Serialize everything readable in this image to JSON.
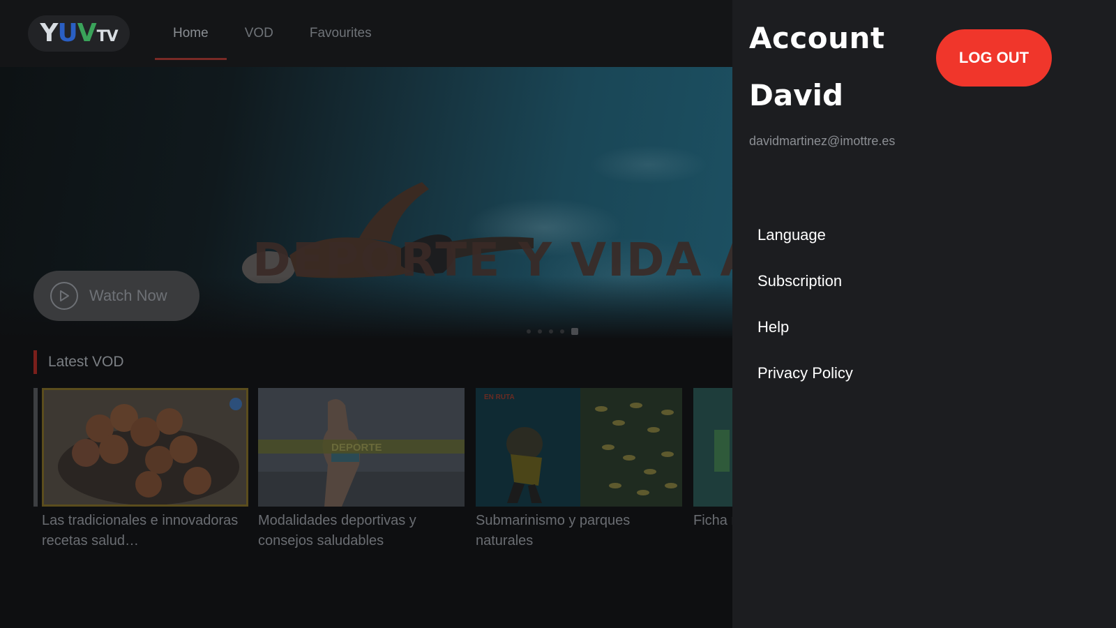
{
  "app": {
    "logo_text": {
      "y": "Y",
      "u": "U",
      "v": "V",
      "tv": "TV"
    }
  },
  "nav": {
    "tabs": [
      {
        "label": "Home",
        "active": true
      },
      {
        "label": "VOD",
        "active": false
      },
      {
        "label": "Favourites",
        "active": false
      }
    ]
  },
  "hero": {
    "title": "DEPORTE Y VIDA AC",
    "watch_label": "Watch Now",
    "carousel_dots": 5,
    "active_dot": 4
  },
  "latest": {
    "title": "Latest VOD",
    "items": [
      {
        "caption": "Las tradicionales e innovadoras recetas salud…",
        "thumb": "walnuts",
        "focused": true
      },
      {
        "caption": "Modalidades deportivas y consejos saludables",
        "thumb": "runner",
        "overlay_text": "DEPORTE",
        "focused": false
      },
      {
        "caption": "Submarinismo y parques naturales",
        "thumb": "diver",
        "overlay_text": "EN RUTA",
        "focused": false
      },
      {
        "caption": "Ficha man",
        "thumb": "partial",
        "focused": false
      }
    ]
  },
  "account": {
    "title": "Account",
    "logout_label": "LOG OUT",
    "user_name": "David",
    "email": "davidmartinez@imottre.es",
    "menu": [
      "Language",
      "Subscription",
      "Help",
      "Privacy Policy"
    ]
  },
  "colors": {
    "accent": "#f0362b",
    "panel_bg": "#1c1d20",
    "dim_bg": "#0e0f11"
  }
}
